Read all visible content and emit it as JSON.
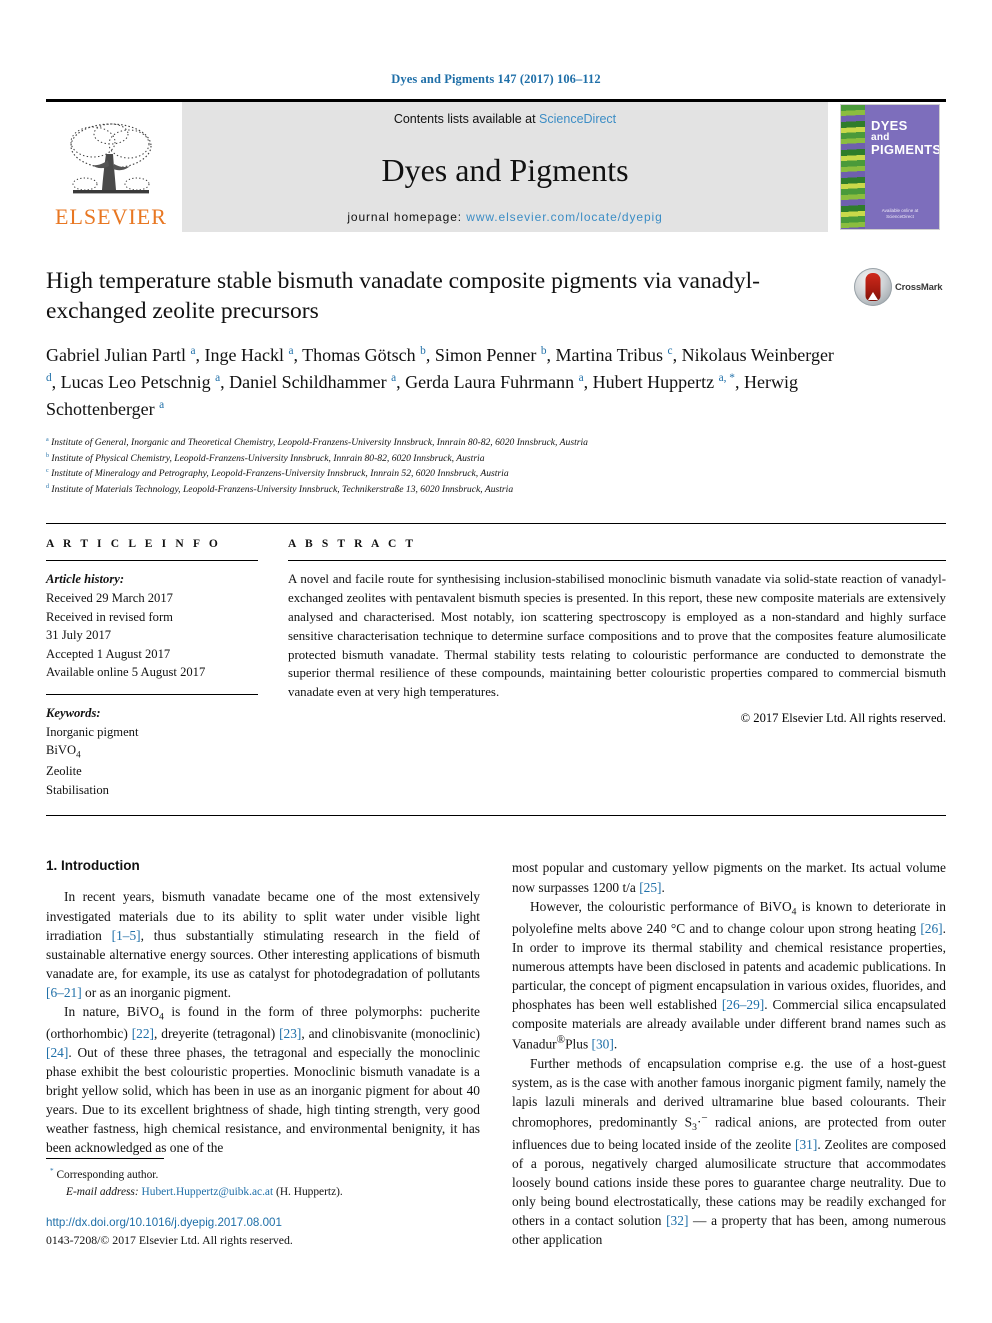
{
  "running_head": "Dyes and Pigments 147 (2017) 106–112",
  "masthead": {
    "publisher_logo_text": "ELSEVIER",
    "contents_prefix": "Contents lists available at ",
    "contents_link": "ScienceDirect",
    "journal_name": "Dyes and Pigments",
    "homepage_prefix": "journal homepage: ",
    "homepage_url": "www.elsevier.com/locate/dyepig",
    "cover": {
      "line1": "DYES",
      "line2": "and",
      "line3": "PIGMENTS",
      "footer": "Available online at ScienceDirect"
    }
  },
  "article": {
    "title": "High temperature stable bismuth vanadate composite pigments via vanadyl-exchanged zeolite precursors",
    "crossmark_label": "CrossMark",
    "authors_html": "Gabriel Julian Partl <sup>a</sup>, Inge Hackl <sup>a</sup>, Thomas Götsch <sup>b</sup>, Simon Penner <sup>b</sup>, Martina Tribus <sup>c</sup>, Nikolaus Weinberger <sup>d</sup>, Lucas Leo Petschnig <sup>a</sup>, Daniel Schildhammer <sup>a</sup>, Gerda Laura Fuhrmann <sup>a</sup>, Hubert Huppertz <sup>a, *</sup>, Herwig Schottenberger <sup>a</sup>",
    "affiliations": [
      {
        "marker": "a",
        "text": "Institute of General, Inorganic and Theoretical Chemistry, Leopold-Franzens-University Innsbruck, Innrain 80-82, 6020 Innsbruck, Austria"
      },
      {
        "marker": "b",
        "text": "Institute of Physical Chemistry, Leopold-Franzens-University Innsbruck, Innrain 80-82, 6020 Innsbruck, Austria"
      },
      {
        "marker": "c",
        "text": "Institute of Mineralogy and Petrography, Leopold-Franzens-University Innsbruck, Innrain 52, 6020 Innsbruck, Austria"
      },
      {
        "marker": "d",
        "text": "Institute of Materials Technology, Leopold-Franzens-University Innsbruck, Technikerstraße 13, 6020 Innsbruck, Austria"
      }
    ]
  },
  "article_info": {
    "heading": "A R T I C L E  I N F O",
    "history_label": "Article history:",
    "history": [
      "Received 29 March 2017",
      "Received in revised form",
      "31 July 2017",
      "Accepted 1 August 2017",
      "Available online 5 August 2017"
    ],
    "keywords_label": "Keywords:",
    "keywords_html": [
      "Inorganic pigment",
      "BiVO<sub>4</sub>",
      "Zeolite",
      "Stabilisation"
    ]
  },
  "abstract": {
    "heading": "A B S T R A C T",
    "text": "A novel and facile route for synthesising inclusion-stabilised monoclinic bismuth vanadate via solid-state reaction of vanadyl-exchanged zeolites with pentavalent bismuth species is presented. In this report, these new composite materials are extensively analysed and characterised. Most notably, ion scattering spectroscopy is employed as a non-standard and highly surface sensitive characterisation technique to determine surface compositions and to prove that the composites feature alumosilicate protected bismuth vanadate. Thermal stability tests relating to colouristic performance are conducted to demonstrate the superior thermal resilience of these compounds, maintaining better colouristic properties compared to commercial bismuth vanadate even at very high temperatures.",
    "copyright": "© 2017 Elsevier Ltd. All rights reserved."
  },
  "body": {
    "section_heading": "1. Introduction",
    "left_paragraphs_html": [
      "In recent years, bismuth vanadate became one of the most extensively investigated materials due to its ability to split water under visible light irradiation <span class=\"ref\">[1–5]</span>, thus substantially stimulating research in the field of sustainable alternative energy sources. Other interesting applications of bismuth vanadate are, for example, its use as catalyst for photodegradation of pollutants <span class=\"ref\">[6–21]</span> or as an inorganic pigment.",
      "In nature, BiVO<sub>4</sub> is found in the form of three polymorphs: pucherite (orthorhombic) <span class=\"ref\">[22]</span>, dreyerite (tetragonal) <span class=\"ref\">[23]</span>, and clinobisvanite (monoclinic) <span class=\"ref\">[24]</span>. Out of these three phases, the tetragonal and especially the monoclinic phase exhibit the best colouristic properties. Monoclinic bismuth vanadate is a bright yellow solid, which has been in use as an inorganic pigment for about 40 years. Due to its excellent brightness of shade, high tinting strength, very good weather fastness, high chemical resistance, and environmental benignity, it has been acknowledged as one of the"
    ],
    "right_paragraphs_html": [
      "most popular and customary yellow pigments on the market. Its actual volume now surpasses 1200 t/a <span class=\"ref\">[25]</span>.",
      "However, the colouristic performance of BiVO<sub>4</sub> is known to deteriorate in polyolefine melts above 240 °C and to change colour upon strong heating <span class=\"ref\">[26]</span>. In order to improve its thermal stability and chemical resistance properties, numerous attempts have been disclosed in patents and academic publications. In particular, the concept of pigment encapsulation in various oxides, fluorides, and phosphates has been well established <span class=\"ref\">[26–29]</span>. Commercial silica encapsulated composite materials are already available under different brand names such as Vanadur<sup>®</sup>Plus <span class=\"ref\">[30]</span>.",
      "Further methods of encapsulation comprise e.g. the use of a host-guest system, as is the case with another famous inorganic pigment family, namely the lapis lazuli minerals and derived ultramarine blue based colourants. Their chromophores, predominantly S<sub>3</sub>·<sup>−</sup> radical anions, are protected from outer influences due to being located inside of the zeolite <span class=\"ref\">[31]</span>. Zeolites are composed of a porous, negatively charged alumosilicate structure that accommodates loosely bound cations inside these pores to guarantee charge neutrality. Due to only being bound electrostatically, these cations may be readily exchanged for others in a contact solution <span class=\"ref\">[32]</span> — a property that has been, among numerous other application"
    ]
  },
  "footer": {
    "corresponding_marker": "*",
    "corresponding_text": "Corresponding author.",
    "email_label": "E-mail address:",
    "email": "Hubert.Huppertz@uibk.ac.at",
    "email_suffix": "(H. Huppertz).",
    "doi": "http://dx.doi.org/10.1016/j.dyepig.2017.08.001",
    "issn_line": "0143-7208/© 2017 Elsevier Ltd. All rights reserved."
  },
  "colors": {
    "link_blue": "#1f6fa8",
    "sciencedirect_blue": "#3c8dc5",
    "elsevier_orange": "#e87722",
    "cover_purple": "#7d6ebc",
    "masthead_grey": "#e3e3e3"
  }
}
